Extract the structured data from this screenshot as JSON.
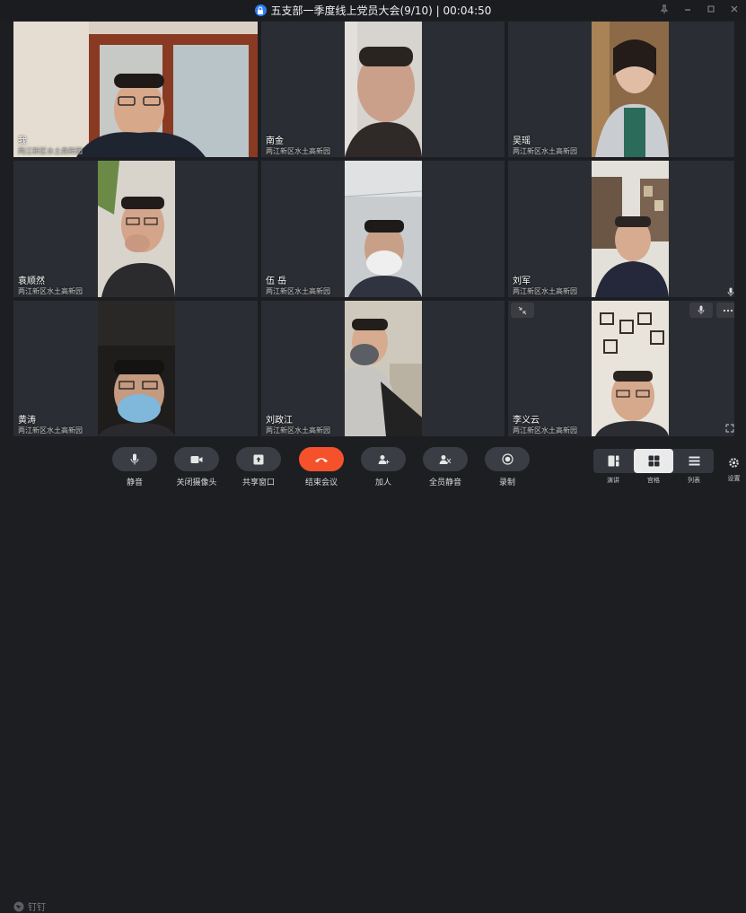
{
  "window": {
    "title": "五支部一季度线上党员大会(9/10) | 00:04:50"
  },
  "participants": [
    {
      "name": "我",
      "org": "两江新区水土高新园"
    },
    {
      "name": "南金",
      "org": "两江新区水土高新园"
    },
    {
      "name": "吴瑶",
      "org": "两江新区水土高新园"
    },
    {
      "name": "袁顺然",
      "org": "两江新区水土高新园"
    },
    {
      "name": "伍 岳",
      "org": "两江新区水土高新园"
    },
    {
      "name": "刘军",
      "org": "两江新区水土高新园"
    },
    {
      "name": "黄涛",
      "org": "两江新区水土高新园"
    },
    {
      "name": "刘政江",
      "org": "两江新区水土高新园"
    },
    {
      "name": "李义云",
      "org": "两江新区水土高新园"
    }
  ],
  "toolbar": {
    "logo": "钉钉",
    "mute": "静音",
    "camera_off": "关闭摄像头",
    "share_window": "共享窗口",
    "end_meeting": "结束会议",
    "add_person": "加人",
    "mute_all": "全员静音",
    "record": "录制",
    "view_speaker": "演讲",
    "view_grid": "宫格",
    "view_list": "列表",
    "settings": "设置"
  },
  "colors": {
    "accent": "#2f7df6",
    "end_call": "#f5522b",
    "background": "#1c1e22",
    "tile": "#2a2d33"
  }
}
